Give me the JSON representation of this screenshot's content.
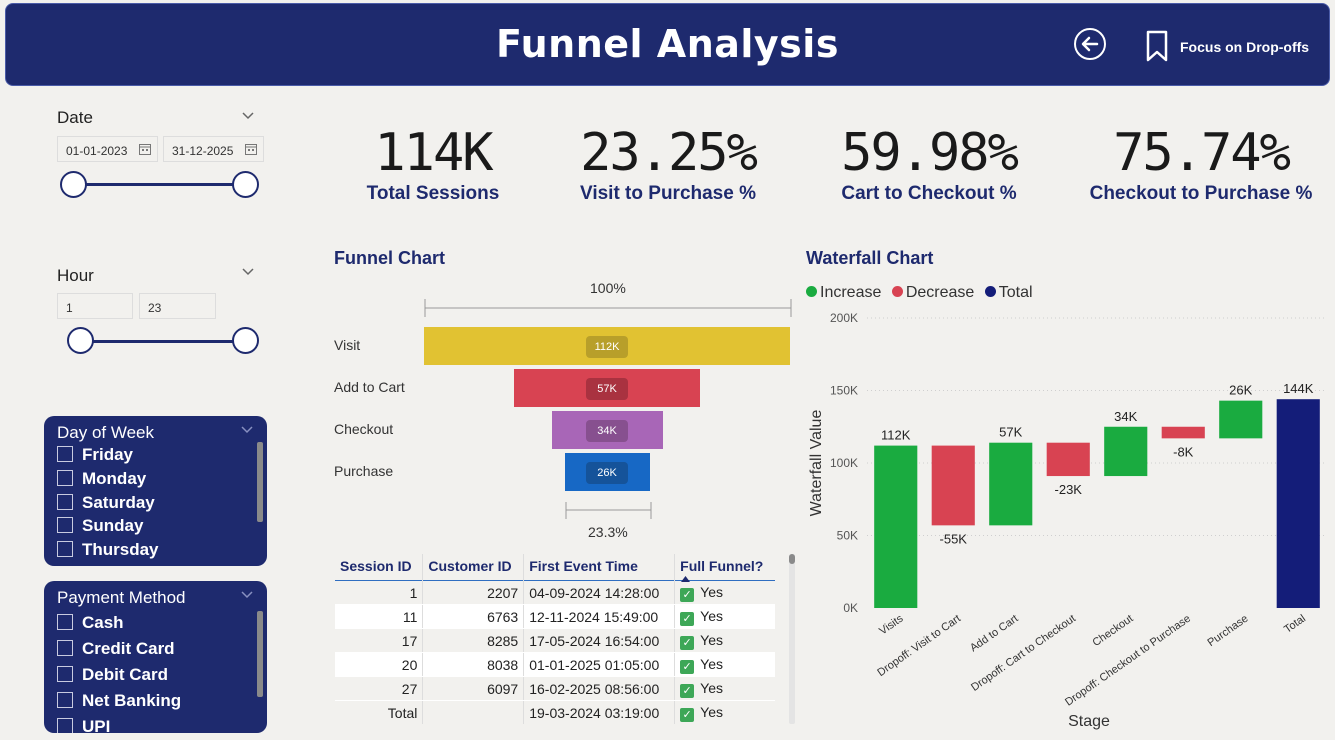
{
  "header": {
    "title": "Funnel Analysis",
    "focus_label": "Focus on Drop-offs"
  },
  "date_slicer": {
    "title": "Date",
    "start": "01-01-2023",
    "end": "31-12-2025"
  },
  "hour_slicer": {
    "title": "Hour",
    "start": "1",
    "end": "23"
  },
  "day_slicer": {
    "title": "Day of Week",
    "items": [
      "Friday",
      "Monday",
      "Saturday",
      "Sunday",
      "Thursday"
    ]
  },
  "payment_slicer": {
    "title": "Payment Method",
    "items": [
      "Cash",
      "Credit Card",
      "Debit Card",
      "Net Banking",
      "UPI"
    ]
  },
  "kpis": [
    {
      "value": "114K",
      "label": "Total Sessions"
    },
    {
      "value": "23.25%",
      "label": "Visit to Purchase %"
    },
    {
      "value": "59.98%",
      "label": "Cart to Checkout %"
    },
    {
      "value": "75.74%",
      "label": "Checkout to Purchase %"
    }
  ],
  "funnel": {
    "title": "Funnel Chart",
    "top_pct": "100%",
    "bottom_pct": "23.3%",
    "stages": [
      {
        "label": "Visit",
        "value": 112,
        "display": "112K",
        "color": "#e1c232",
        "pill": "#b89f2a"
      },
      {
        "label": "Add to Cart",
        "value": 57,
        "display": "57K",
        "color": "#d84352",
        "pill": "#a93240"
      },
      {
        "label": "Checkout",
        "value": 34,
        "display": "34K",
        "color": "#a866b7",
        "pill": "#87508f"
      },
      {
        "label": "Purchase",
        "value": 26,
        "display": "26K",
        "color": "#1768c5",
        "pill": "#15539a"
      }
    ]
  },
  "table": {
    "headers": [
      "Session ID",
      "Customer ID",
      "First Event Time",
      "Full Funnel?"
    ],
    "rows": [
      {
        "session": "1",
        "customer": "2207",
        "time": "04-09-2024 14:28:00",
        "full": "Yes"
      },
      {
        "session": "11",
        "customer": "6763",
        "time": "12-11-2024 15:49:00",
        "full": "Yes"
      },
      {
        "session": "17",
        "customer": "8285",
        "time": "17-05-2024 16:54:00",
        "full": "Yes"
      },
      {
        "session": "20",
        "customer": "8038",
        "time": "01-01-2025 01:05:00",
        "full": "Yes"
      },
      {
        "session": "27",
        "customer": "6097",
        "time": "16-02-2025 08:56:00",
        "full": "Yes"
      }
    ],
    "total": {
      "label": "Total",
      "time": "19-03-2024 03:19:00",
      "full": "Yes"
    }
  },
  "chart_data": {
    "type": "waterfall",
    "title": "Waterfall Chart",
    "xlabel": "Stage",
    "ylabel": "Waterfall Value",
    "ylim": [
      0,
      200000
    ],
    "yticks": [
      "0K",
      "50K",
      "100K",
      "150K",
      "200K"
    ],
    "legend": [
      {
        "name": "Increase",
        "color": "#1aab40"
      },
      {
        "name": "Decrease",
        "color": "#d84352"
      },
      {
        "name": "Total",
        "color": "#141d79"
      }
    ],
    "categories": [
      "Visits",
      "Dropoff: Visit to Cart",
      "Add to Cart",
      "Dropoff: Cart to Checkout",
      "Checkout",
      "Dropoff: Checkout to Purchase",
      "Purchase",
      "Total"
    ],
    "deltas": [
      112,
      -55,
      57,
      -23,
      34,
      -8,
      26,
      144
    ],
    "data_labels": [
      "112K",
      "-55K",
      "57K",
      "-23K",
      "34K",
      "-8K",
      "26K",
      "144K"
    ]
  }
}
